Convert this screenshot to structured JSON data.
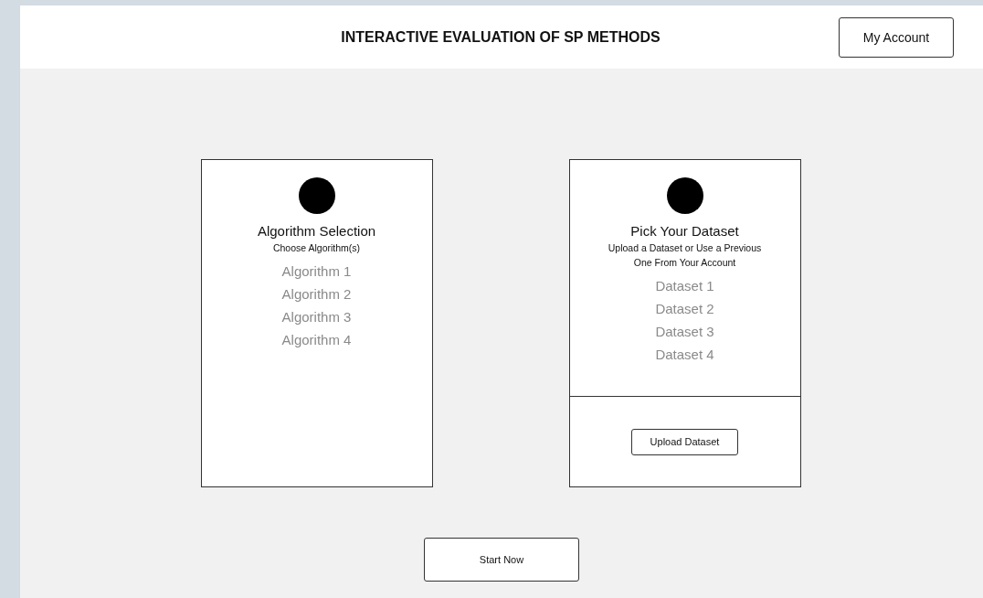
{
  "header": {
    "title": "INTERACTIVE EVALUATION OF SP METHODS",
    "account_button": "My Account"
  },
  "cards": [
    {
      "title": "Algorithm Selection",
      "subtitle": "Choose Algorithm(s)",
      "items": [
        "Algorithm 1",
        "Algorithm 2",
        "Algorithm 3",
        "Algorithm 4"
      ]
    },
    {
      "title": "Pick Your Dataset",
      "subtitle": "Upload a Dataset or Use a Previous One From Your Account",
      "items": [
        "Dataset 1",
        "Dataset 2",
        "Dataset 3",
        "Dataset 4"
      ],
      "footer_button": "Upload Dataset"
    }
  ],
  "start_button": "Start Now"
}
